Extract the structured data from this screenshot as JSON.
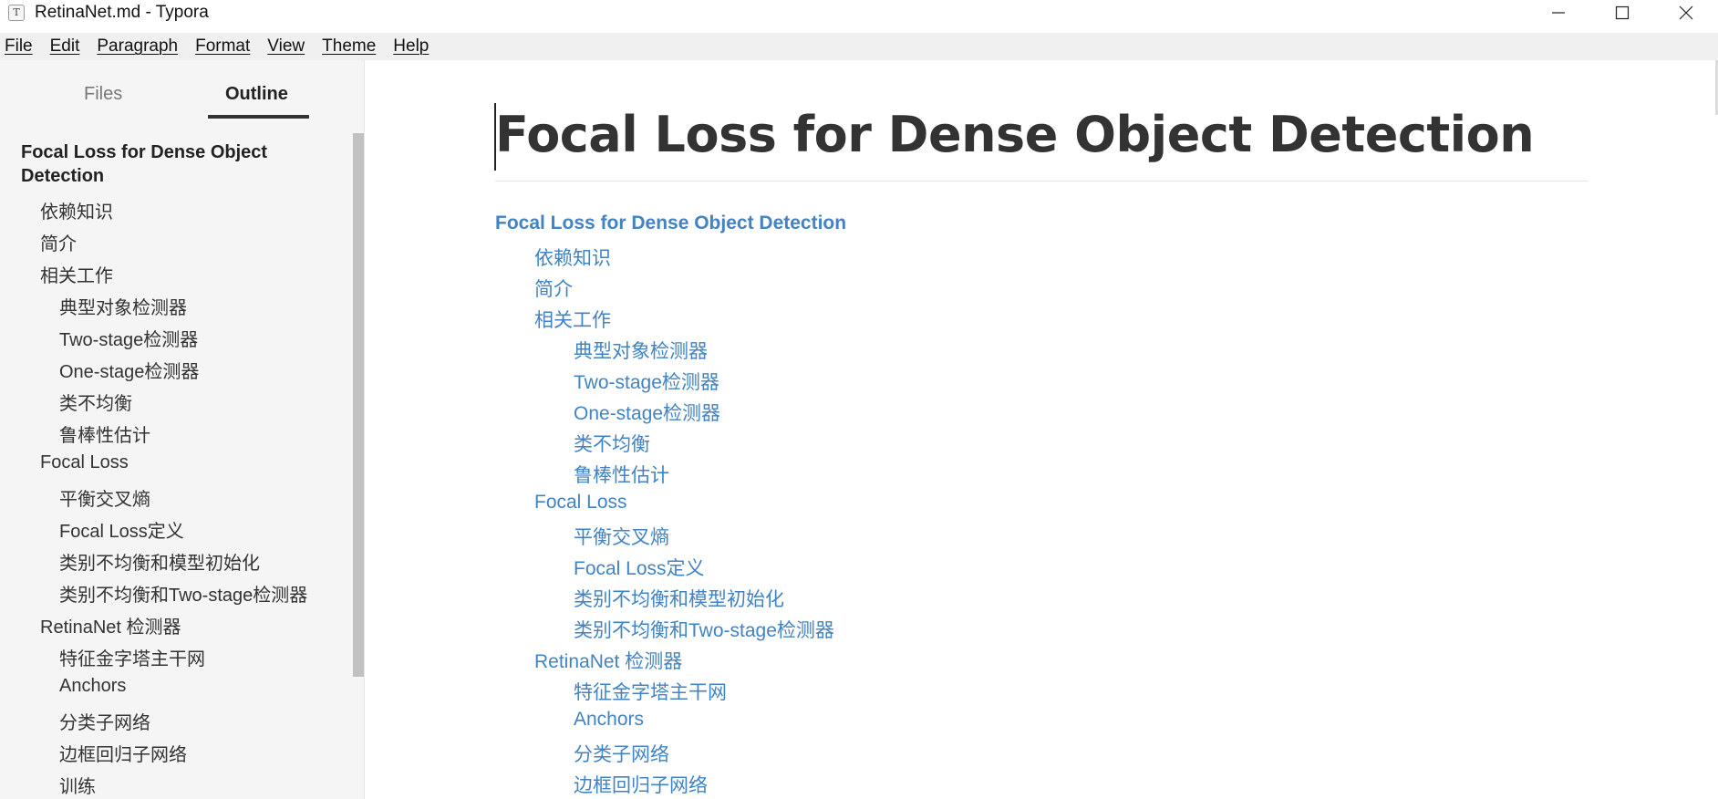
{
  "window": {
    "title": "RetinaNet.md - Typora",
    "app_icon_letter": "T"
  },
  "menu": [
    "File",
    "Edit",
    "Paragraph",
    "Format",
    "View",
    "Theme",
    "Help"
  ],
  "sidebar": {
    "tabs": {
      "files": "Files",
      "outline": "Outline",
      "active": "Outline"
    },
    "outline": [
      {
        "level": 1,
        "label": "Focal Loss for Dense Object Detection"
      },
      {
        "level": 2,
        "label": "依赖知识"
      },
      {
        "level": 2,
        "label": "简介"
      },
      {
        "level": 2,
        "label": "相关工作"
      },
      {
        "level": 3,
        "label": "典型对象检测器"
      },
      {
        "level": 3,
        "label": "Two-stage检测器"
      },
      {
        "level": 3,
        "label": "One-stage检测器"
      },
      {
        "level": 3,
        "label": "类不均衡"
      },
      {
        "level": 3,
        "label": "鲁棒性估计"
      },
      {
        "level": 2,
        "label": "Focal Loss"
      },
      {
        "level": 3,
        "label": "平衡交叉熵"
      },
      {
        "level": 3,
        "label": "Focal Loss定义"
      },
      {
        "level": 3,
        "label": "类别不均衡和模型初始化"
      },
      {
        "level": 3,
        "label": "类别不均衡和Two-stage检测器"
      },
      {
        "level": 2,
        "label": "RetinaNet 检测器"
      },
      {
        "level": 3,
        "label": "特征金字塔主干网"
      },
      {
        "level": 3,
        "label": "Anchors"
      },
      {
        "level": 3,
        "label": "分类子网络"
      },
      {
        "level": 3,
        "label": "边框回归子网络"
      },
      {
        "level": 3,
        "label": "训练"
      }
    ]
  },
  "document": {
    "title": "Focal Loss for Dense Object Detection",
    "toc": [
      {
        "level": 1,
        "label": "Focal Loss for Dense Object Detection"
      },
      {
        "level": 2,
        "label": "依赖知识"
      },
      {
        "level": 2,
        "label": "简介"
      },
      {
        "level": 2,
        "label": "相关工作"
      },
      {
        "level": 3,
        "label": "典型对象检测器"
      },
      {
        "level": 3,
        "label": "Two-stage检测器"
      },
      {
        "level": 3,
        "label": "One-stage检测器"
      },
      {
        "level": 3,
        "label": "类不均衡"
      },
      {
        "level": 3,
        "label": "鲁棒性估计"
      },
      {
        "level": 2,
        "label": "Focal Loss"
      },
      {
        "level": 3,
        "label": "平衡交叉熵"
      },
      {
        "level": 3,
        "label": "Focal Loss定义"
      },
      {
        "level": 3,
        "label": "类别不均衡和模型初始化"
      },
      {
        "level": 3,
        "label": "类别不均衡和Two-stage检测器"
      },
      {
        "level": 2,
        "label": "RetinaNet 检测器"
      },
      {
        "level": 3,
        "label": "特征金字塔主干网"
      },
      {
        "level": 3,
        "label": "Anchors"
      },
      {
        "level": 3,
        "label": "分类子网络"
      },
      {
        "level": 3,
        "label": "边框回归子网络"
      }
    ]
  },
  "colors": {
    "link": "#4183c4",
    "sidebar_bg": "#f5f5f5",
    "menubar_bg": "#f0f0f0",
    "text": "#333333"
  }
}
